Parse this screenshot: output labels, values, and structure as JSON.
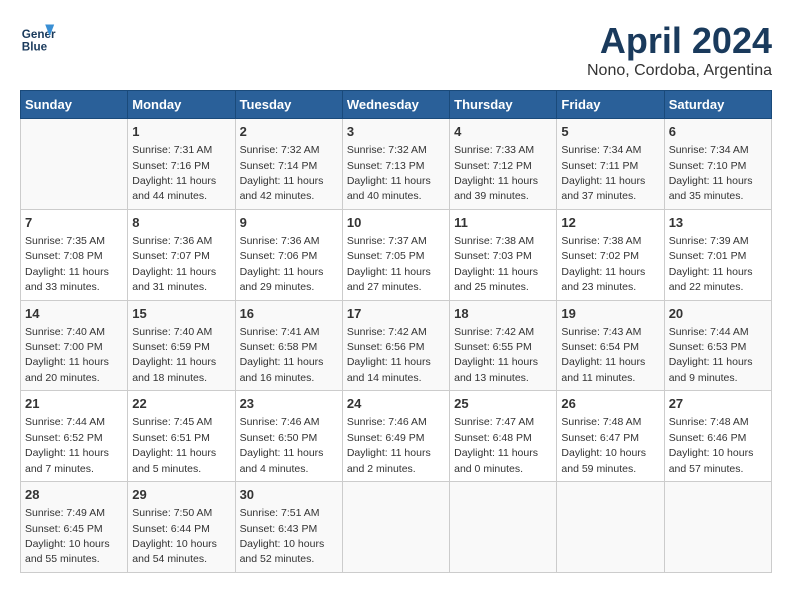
{
  "header": {
    "logo_line1": "General",
    "logo_line2": "Blue",
    "month": "April 2024",
    "location": "Nono, Cordoba, Argentina"
  },
  "weekdays": [
    "Sunday",
    "Monday",
    "Tuesday",
    "Wednesday",
    "Thursday",
    "Friday",
    "Saturday"
  ],
  "weeks": [
    [
      {
        "day": "",
        "sunrise": "",
        "sunset": "",
        "daylight": ""
      },
      {
        "day": "1",
        "sunrise": "Sunrise: 7:31 AM",
        "sunset": "Sunset: 7:16 PM",
        "daylight": "Daylight: 11 hours and 44 minutes."
      },
      {
        "day": "2",
        "sunrise": "Sunrise: 7:32 AM",
        "sunset": "Sunset: 7:14 PM",
        "daylight": "Daylight: 11 hours and 42 minutes."
      },
      {
        "day": "3",
        "sunrise": "Sunrise: 7:32 AM",
        "sunset": "Sunset: 7:13 PM",
        "daylight": "Daylight: 11 hours and 40 minutes."
      },
      {
        "day": "4",
        "sunrise": "Sunrise: 7:33 AM",
        "sunset": "Sunset: 7:12 PM",
        "daylight": "Daylight: 11 hours and 39 minutes."
      },
      {
        "day": "5",
        "sunrise": "Sunrise: 7:34 AM",
        "sunset": "Sunset: 7:11 PM",
        "daylight": "Daylight: 11 hours and 37 minutes."
      },
      {
        "day": "6",
        "sunrise": "Sunrise: 7:34 AM",
        "sunset": "Sunset: 7:10 PM",
        "daylight": "Daylight: 11 hours and 35 minutes."
      }
    ],
    [
      {
        "day": "7",
        "sunrise": "Sunrise: 7:35 AM",
        "sunset": "Sunset: 7:08 PM",
        "daylight": "Daylight: 11 hours and 33 minutes."
      },
      {
        "day": "8",
        "sunrise": "Sunrise: 7:36 AM",
        "sunset": "Sunset: 7:07 PM",
        "daylight": "Daylight: 11 hours and 31 minutes."
      },
      {
        "day": "9",
        "sunrise": "Sunrise: 7:36 AM",
        "sunset": "Sunset: 7:06 PM",
        "daylight": "Daylight: 11 hours and 29 minutes."
      },
      {
        "day": "10",
        "sunrise": "Sunrise: 7:37 AM",
        "sunset": "Sunset: 7:05 PM",
        "daylight": "Daylight: 11 hours and 27 minutes."
      },
      {
        "day": "11",
        "sunrise": "Sunrise: 7:38 AM",
        "sunset": "Sunset: 7:03 PM",
        "daylight": "Daylight: 11 hours and 25 minutes."
      },
      {
        "day": "12",
        "sunrise": "Sunrise: 7:38 AM",
        "sunset": "Sunset: 7:02 PM",
        "daylight": "Daylight: 11 hours and 23 minutes."
      },
      {
        "day": "13",
        "sunrise": "Sunrise: 7:39 AM",
        "sunset": "Sunset: 7:01 PM",
        "daylight": "Daylight: 11 hours and 22 minutes."
      }
    ],
    [
      {
        "day": "14",
        "sunrise": "Sunrise: 7:40 AM",
        "sunset": "Sunset: 7:00 PM",
        "daylight": "Daylight: 11 hours and 20 minutes."
      },
      {
        "day": "15",
        "sunrise": "Sunrise: 7:40 AM",
        "sunset": "Sunset: 6:59 PM",
        "daylight": "Daylight: 11 hours and 18 minutes."
      },
      {
        "day": "16",
        "sunrise": "Sunrise: 7:41 AM",
        "sunset": "Sunset: 6:58 PM",
        "daylight": "Daylight: 11 hours and 16 minutes."
      },
      {
        "day": "17",
        "sunrise": "Sunrise: 7:42 AM",
        "sunset": "Sunset: 6:56 PM",
        "daylight": "Daylight: 11 hours and 14 minutes."
      },
      {
        "day": "18",
        "sunrise": "Sunrise: 7:42 AM",
        "sunset": "Sunset: 6:55 PM",
        "daylight": "Daylight: 11 hours and 13 minutes."
      },
      {
        "day": "19",
        "sunrise": "Sunrise: 7:43 AM",
        "sunset": "Sunset: 6:54 PM",
        "daylight": "Daylight: 11 hours and 11 minutes."
      },
      {
        "day": "20",
        "sunrise": "Sunrise: 7:44 AM",
        "sunset": "Sunset: 6:53 PM",
        "daylight": "Daylight: 11 hours and 9 minutes."
      }
    ],
    [
      {
        "day": "21",
        "sunrise": "Sunrise: 7:44 AM",
        "sunset": "Sunset: 6:52 PM",
        "daylight": "Daylight: 11 hours and 7 minutes."
      },
      {
        "day": "22",
        "sunrise": "Sunrise: 7:45 AM",
        "sunset": "Sunset: 6:51 PM",
        "daylight": "Daylight: 11 hours and 5 minutes."
      },
      {
        "day": "23",
        "sunrise": "Sunrise: 7:46 AM",
        "sunset": "Sunset: 6:50 PM",
        "daylight": "Daylight: 11 hours and 4 minutes."
      },
      {
        "day": "24",
        "sunrise": "Sunrise: 7:46 AM",
        "sunset": "Sunset: 6:49 PM",
        "daylight": "Daylight: 11 hours and 2 minutes."
      },
      {
        "day": "25",
        "sunrise": "Sunrise: 7:47 AM",
        "sunset": "Sunset: 6:48 PM",
        "daylight": "Daylight: 11 hours and 0 minutes."
      },
      {
        "day": "26",
        "sunrise": "Sunrise: 7:48 AM",
        "sunset": "Sunset: 6:47 PM",
        "daylight": "Daylight: 10 hours and 59 minutes."
      },
      {
        "day": "27",
        "sunrise": "Sunrise: 7:48 AM",
        "sunset": "Sunset: 6:46 PM",
        "daylight": "Daylight: 10 hours and 57 minutes."
      }
    ],
    [
      {
        "day": "28",
        "sunrise": "Sunrise: 7:49 AM",
        "sunset": "Sunset: 6:45 PM",
        "daylight": "Daylight: 10 hours and 55 minutes."
      },
      {
        "day": "29",
        "sunrise": "Sunrise: 7:50 AM",
        "sunset": "Sunset: 6:44 PM",
        "daylight": "Daylight: 10 hours and 54 minutes."
      },
      {
        "day": "30",
        "sunrise": "Sunrise: 7:51 AM",
        "sunset": "Sunset: 6:43 PM",
        "daylight": "Daylight: 10 hours and 52 minutes."
      },
      {
        "day": "",
        "sunrise": "",
        "sunset": "",
        "daylight": ""
      },
      {
        "day": "",
        "sunrise": "",
        "sunset": "",
        "daylight": ""
      },
      {
        "day": "",
        "sunrise": "",
        "sunset": "",
        "daylight": ""
      },
      {
        "day": "",
        "sunrise": "",
        "sunset": "",
        "daylight": ""
      }
    ]
  ]
}
